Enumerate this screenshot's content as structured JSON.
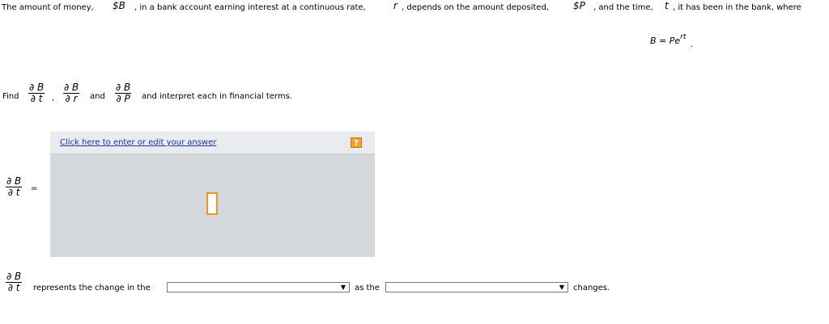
{
  "problem": {
    "t1": "The amount of money,",
    "v_B": "$B",
    "t2": ", in a bank account earning interest at a continuous rate,",
    "v_r": "r",
    "t3": ", depends on the amount deposited,",
    "v_P": "$P",
    "t4": ", and the time,",
    "v_t": "t",
    "t5": ", it has been in the bank, where",
    "formula_lhs": "B = Pe",
    "formula_exp": "rt",
    "formula_end": "."
  },
  "find": {
    "find_label": "Find",
    "f1_num": "∂ B",
    "f1_den": "∂ t",
    "comma": ",",
    "f2_num": "∂ B",
    "f2_den": "∂ r",
    "and_label": "and",
    "f3_num": "∂ B",
    "f3_den": "∂ P",
    "tail": "and interpret each in financial terms."
  },
  "answer": {
    "lhs_num": "∂ B",
    "lhs_den": "∂ t",
    "equals": "=",
    "edit_link": "Click here to enter or edit your answer",
    "help_icon": "?"
  },
  "interpret": {
    "frac_num": "∂ B",
    "frac_den": "∂ t",
    "represents": "represents the change in the",
    "as_the": "as the",
    "changes": "changes.",
    "select1_value": "",
    "select2_value": "",
    "arrow": "▼"
  }
}
